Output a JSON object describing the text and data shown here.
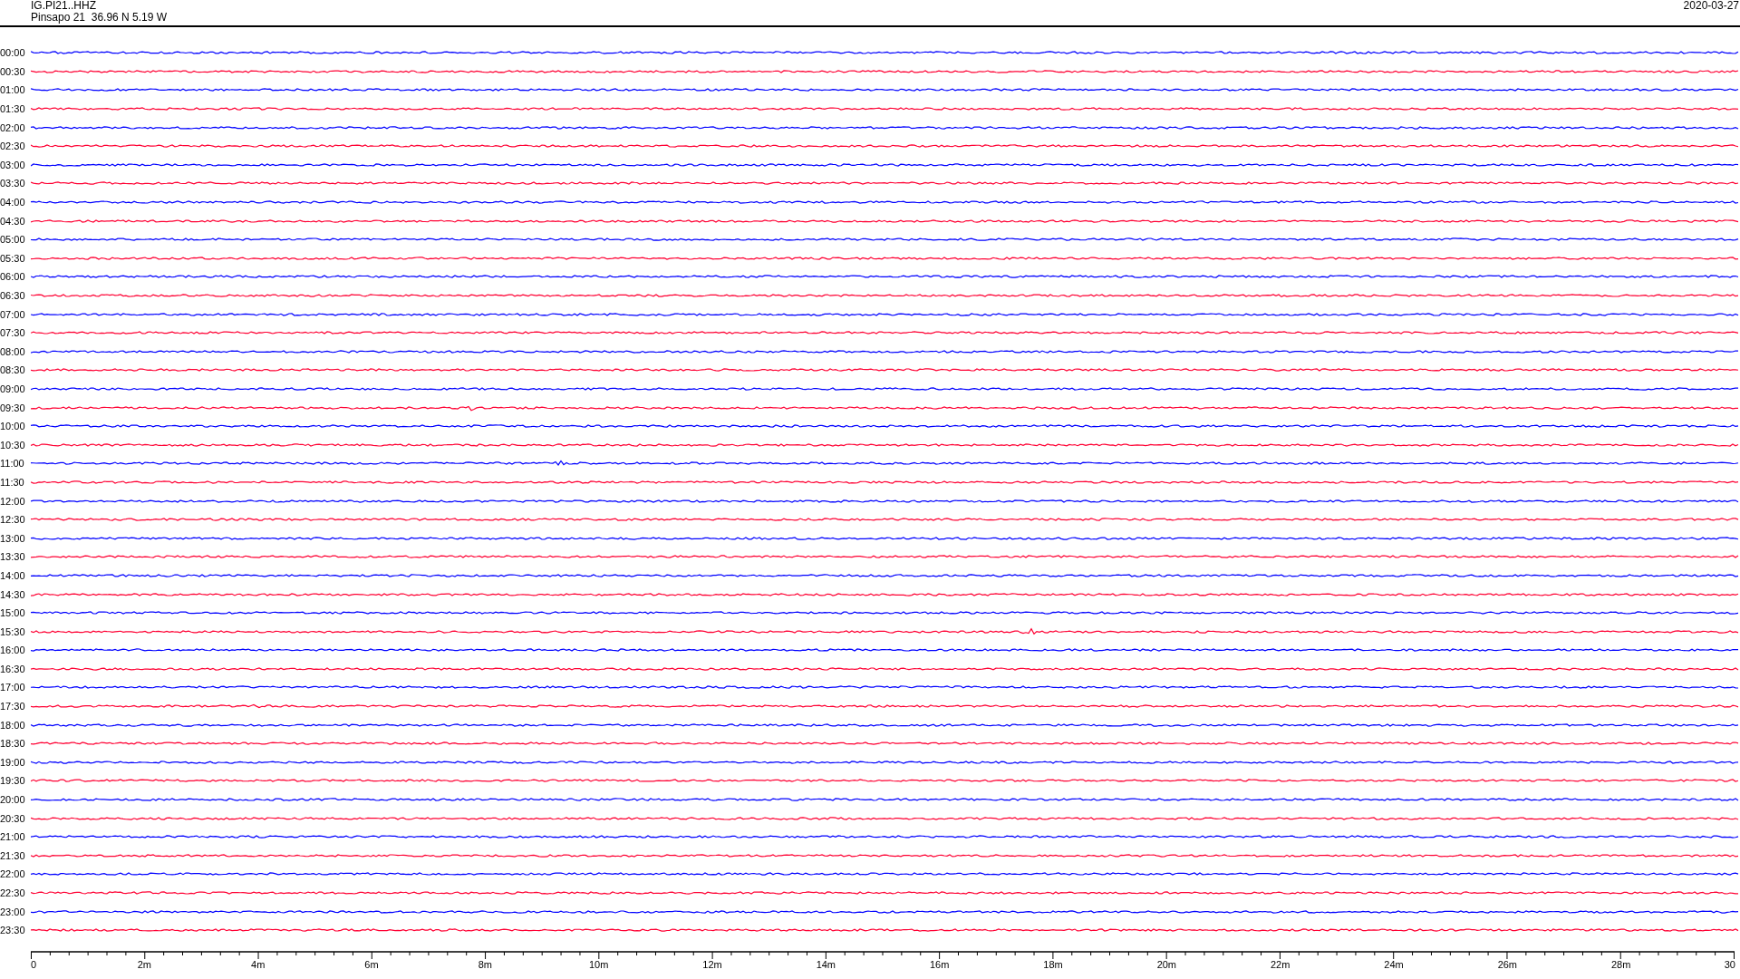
{
  "header": {
    "station": "IG.PI21..HHZ",
    "location": "Pinsapo 21  36.96 N 5.19 W",
    "date": "2020-03-27"
  },
  "traces": [
    {
      "label": "00:00",
      "color": "#0000ff"
    },
    {
      "label": "00:30",
      "color": "#ff0033"
    },
    {
      "label": "01:00",
      "color": "#0000ff"
    },
    {
      "label": "01:30",
      "color": "#ff0033"
    },
    {
      "label": "02:00",
      "color": "#0000ff"
    },
    {
      "label": "02:30",
      "color": "#ff0033"
    },
    {
      "label": "03:00",
      "color": "#0000ff"
    },
    {
      "label": "03:30",
      "color": "#ff0033"
    },
    {
      "label": "04:00",
      "color": "#0000ff"
    },
    {
      "label": "04:30",
      "color": "#ff0033"
    },
    {
      "label": "05:00",
      "color": "#0000ff"
    },
    {
      "label": "05:30",
      "color": "#ff0033"
    },
    {
      "label": "06:00",
      "color": "#0000ff"
    },
    {
      "label": "06:30",
      "color": "#ff0033"
    },
    {
      "label": "07:00",
      "color": "#0000ff"
    },
    {
      "label": "07:30",
      "color": "#ff0033"
    },
    {
      "label": "08:00",
      "color": "#0000ff"
    },
    {
      "label": "08:30",
      "color": "#ff0033"
    },
    {
      "label": "09:00",
      "color": "#0000ff"
    },
    {
      "label": "09:30",
      "color": "#ff0033"
    },
    {
      "label": "10:00",
      "color": "#0000ff"
    },
    {
      "label": "10:30",
      "color": "#ff0033"
    },
    {
      "label": "11:00",
      "color": "#0000ff"
    },
    {
      "label": "11:30",
      "color": "#ff0033"
    },
    {
      "label": "12:00",
      "color": "#0000ff"
    },
    {
      "label": "12:30",
      "color": "#ff0033"
    },
    {
      "label": "13:00",
      "color": "#0000ff"
    },
    {
      "label": "13:30",
      "color": "#ff0033"
    },
    {
      "label": "14:00",
      "color": "#0000ff"
    },
    {
      "label": "14:30",
      "color": "#ff0033"
    },
    {
      "label": "15:00",
      "color": "#0000ff"
    },
    {
      "label": "15:30",
      "color": "#ff0033"
    },
    {
      "label": "16:00",
      "color": "#0000ff"
    },
    {
      "label": "16:30",
      "color": "#ff0033"
    },
    {
      "label": "17:00",
      "color": "#0000ff"
    },
    {
      "label": "17:30",
      "color": "#ff0033"
    },
    {
      "label": "18:00",
      "color": "#0000ff"
    },
    {
      "label": "18:30",
      "color": "#ff0033"
    },
    {
      "label": "19:00",
      "color": "#0000ff"
    },
    {
      "label": "19:30",
      "color": "#ff0033"
    },
    {
      "label": "20:00",
      "color": "#0000ff"
    },
    {
      "label": "20:30",
      "color": "#ff0033"
    },
    {
      "label": "21:00",
      "color": "#0000ff"
    },
    {
      "label": "21:30",
      "color": "#ff0033"
    },
    {
      "label": "22:00",
      "color": "#0000ff"
    },
    {
      "label": "22:30",
      "color": "#ff0033"
    },
    {
      "label": "23:00",
      "color": "#0000ff"
    },
    {
      "label": "23:30",
      "color": "#ff0033"
    }
  ],
  "axis": {
    "ticks": [
      "0",
      "2m",
      "4m",
      "6m",
      "8m",
      "10m",
      "12m",
      "14m",
      "16m",
      "18m",
      "20m",
      "22m",
      "24m",
      "26m",
      "28m",
      "30"
    ]
  }
}
